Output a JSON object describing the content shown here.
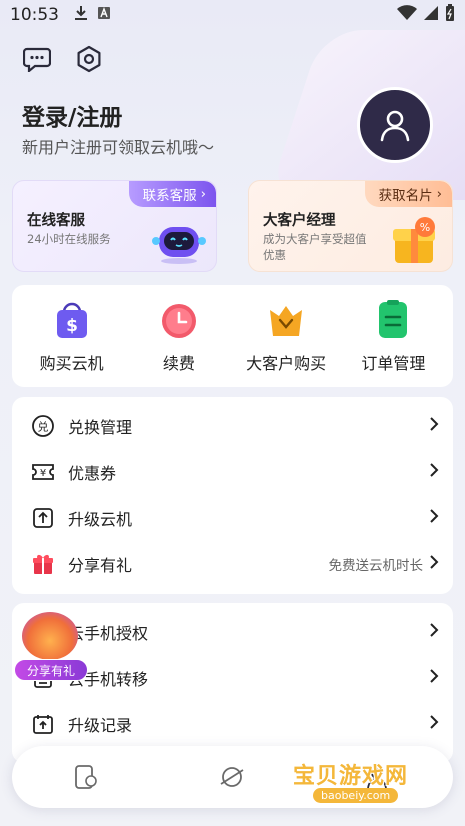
{
  "status_bar": {
    "time": "10:53"
  },
  "header": {
    "login_title": "登录/注册",
    "login_subtitle": "新用户注册可领取云机哦～"
  },
  "cards": [
    {
      "tag": "联系客服",
      "title": "在线客服",
      "subtitle": "24小时在线服务"
    },
    {
      "tag": "获取名片",
      "title": "大客户经理",
      "subtitle": "成为大客户享受超值优惠"
    }
  ],
  "quick_actions": [
    {
      "label": "购买云机",
      "icon": "shopping-bag-icon",
      "color": "#6e5bf0"
    },
    {
      "label": "续费",
      "icon": "alarm-clock-icon",
      "color": "#f25a6b"
    },
    {
      "label": "大客户购买",
      "icon": "crown-bag-icon",
      "color": "#f5a623"
    },
    {
      "label": "订单管理",
      "icon": "order-list-icon",
      "color": "#22c46d"
    }
  ],
  "menu_group_1": [
    {
      "label": "兑换管理",
      "icon": "redeem-icon",
      "extra": ""
    },
    {
      "label": "优惠券",
      "icon": "coupon-icon",
      "extra": ""
    },
    {
      "label": "升级云机",
      "icon": "upgrade-icon",
      "extra": ""
    },
    {
      "label": "分享有礼",
      "icon": "gift-icon",
      "extra": "免费送云机时长"
    }
  ],
  "menu_group_2": [
    {
      "label": "云手机授权",
      "icon": "authorize-icon",
      "extra": ""
    },
    {
      "label": "云手机转移",
      "icon": "transfer-icon",
      "extra": ""
    },
    {
      "label": "升级记录",
      "icon": "upgrade-record-icon",
      "extra": ""
    }
  ],
  "share_badge": {
    "label": "分享有礼"
  },
  "watermark": {
    "text": "宝贝游戏网",
    "url": "baobeiy.com"
  },
  "colors": {
    "accent": "#7c54ee",
    "avatar_bg": "#2f2a48"
  }
}
